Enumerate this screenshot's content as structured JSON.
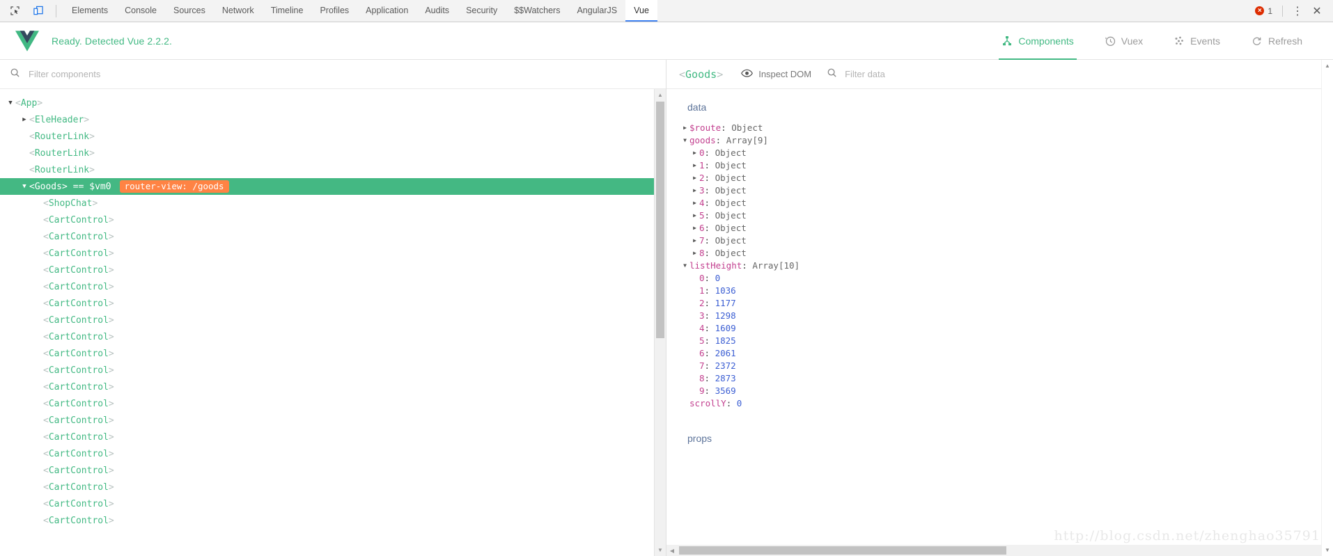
{
  "devtools_toolbar": {
    "icons": [
      {
        "name": "inspect-element-icon",
        "label": "Inspect element"
      },
      {
        "name": "device-toolbar-icon",
        "label": "Toggle device toolbar"
      }
    ],
    "tabs": [
      {
        "label": "Elements",
        "active": false
      },
      {
        "label": "Console",
        "active": false
      },
      {
        "label": "Sources",
        "active": false
      },
      {
        "label": "Network",
        "active": false
      },
      {
        "label": "Timeline",
        "active": false
      },
      {
        "label": "Profiles",
        "active": false
      },
      {
        "label": "Application",
        "active": false
      },
      {
        "label": "Audits",
        "active": false
      },
      {
        "label": "Security",
        "active": false
      },
      {
        "label": "$$Watchers",
        "active": false
      },
      {
        "label": "AngularJS",
        "active": false
      },
      {
        "label": "Vue",
        "active": true
      }
    ],
    "error_count": "1",
    "error_mark": "×",
    "kebab_label": "⋮",
    "close_label": "✕",
    "active_tab_underline_color": "#4285f4",
    "error_color": "#dd2c00"
  },
  "vue_header": {
    "status": "Ready. Detected Vue 2.2.2.",
    "accent_color": "#42b983",
    "nav": [
      {
        "label": "Components",
        "icon": "components-tree-icon",
        "active": true
      },
      {
        "label": "Vuex",
        "icon": "clock-history-icon",
        "active": false
      },
      {
        "label": "Events",
        "icon": "events-dots-icon",
        "active": false
      },
      {
        "label": "Refresh",
        "icon": "refresh-icon",
        "active": false
      }
    ]
  },
  "tree_panel": {
    "filter": {
      "value": "",
      "placeholder": "Filter components",
      "icon": "search-icon"
    },
    "rows": [
      {
        "name": "App",
        "depth": 0,
        "arrow": "down",
        "selected": false
      },
      {
        "name": "EleHeader",
        "depth": 1,
        "arrow": "right",
        "selected": false
      },
      {
        "name": "RouterLink",
        "depth": 1,
        "arrow": "none",
        "selected": false
      },
      {
        "name": "RouterLink",
        "depth": 1,
        "arrow": "none",
        "selected": false
      },
      {
        "name": "RouterLink",
        "depth": 1,
        "arrow": "none",
        "selected": false
      },
      {
        "name": "Goods",
        "depth": 1,
        "arrow": "down",
        "selected": true,
        "vm": "== $vm0",
        "badge": "router-view: /goods"
      },
      {
        "name": "ShopChat",
        "depth": 2,
        "arrow": "none",
        "selected": false
      },
      {
        "name": "CartControl",
        "depth": 2,
        "arrow": "none",
        "selected": false
      },
      {
        "name": "CartControl",
        "depth": 2,
        "arrow": "none",
        "selected": false
      },
      {
        "name": "CartControl",
        "depth": 2,
        "arrow": "none",
        "selected": false
      },
      {
        "name": "CartControl",
        "depth": 2,
        "arrow": "none",
        "selected": false
      },
      {
        "name": "CartControl",
        "depth": 2,
        "arrow": "none",
        "selected": false
      },
      {
        "name": "CartControl",
        "depth": 2,
        "arrow": "none",
        "selected": false
      },
      {
        "name": "CartControl",
        "depth": 2,
        "arrow": "none",
        "selected": false
      },
      {
        "name": "CartControl",
        "depth": 2,
        "arrow": "none",
        "selected": false
      },
      {
        "name": "CartControl",
        "depth": 2,
        "arrow": "none",
        "selected": false
      },
      {
        "name": "CartControl",
        "depth": 2,
        "arrow": "none",
        "selected": false
      },
      {
        "name": "CartControl",
        "depth": 2,
        "arrow": "none",
        "selected": false
      },
      {
        "name": "CartControl",
        "depth": 2,
        "arrow": "none",
        "selected": false
      },
      {
        "name": "CartControl",
        "depth": 2,
        "arrow": "none",
        "selected": false
      },
      {
        "name": "CartControl",
        "depth": 2,
        "arrow": "none",
        "selected": false
      },
      {
        "name": "CartControl",
        "depth": 2,
        "arrow": "none",
        "selected": false
      },
      {
        "name": "CartControl",
        "depth": 2,
        "arrow": "none",
        "selected": false
      },
      {
        "name": "CartControl",
        "depth": 2,
        "arrow": "none",
        "selected": false
      },
      {
        "name": "CartControl",
        "depth": 2,
        "arrow": "none",
        "selected": false
      },
      {
        "name": "CartControl",
        "depth": 2,
        "arrow": "none",
        "selected": false
      }
    ],
    "selected_bg": "#44b883",
    "badge_bg": "#ff8344"
  },
  "inspector": {
    "title_open": "<",
    "title_name": "Goods",
    "title_close": ">",
    "inspect_dom": {
      "label": "Inspect DOM",
      "icon": "eye-icon"
    },
    "filter": {
      "value": "",
      "placeholder": "Filter data",
      "icon": "search-icon"
    },
    "sections": [
      {
        "title": "data"
      },
      {
        "title": "props"
      }
    ],
    "data_rows": [
      {
        "arrow": "right",
        "depth": 0,
        "key": "$route",
        "value": "Object",
        "vtype": "obj"
      },
      {
        "arrow": "down",
        "depth": 0,
        "key": "goods",
        "value": "Array[9]",
        "vtype": "obj"
      },
      {
        "arrow": "right",
        "depth": 1,
        "key": "0",
        "value": "Object",
        "vtype": "obj"
      },
      {
        "arrow": "right",
        "depth": 1,
        "key": "1",
        "value": "Object",
        "vtype": "obj"
      },
      {
        "arrow": "right",
        "depth": 1,
        "key": "2",
        "value": "Object",
        "vtype": "obj"
      },
      {
        "arrow": "right",
        "depth": 1,
        "key": "3",
        "value": "Object",
        "vtype": "obj"
      },
      {
        "arrow": "right",
        "depth": 1,
        "key": "4",
        "value": "Object",
        "vtype": "obj"
      },
      {
        "arrow": "right",
        "depth": 1,
        "key": "5",
        "value": "Object",
        "vtype": "obj"
      },
      {
        "arrow": "right",
        "depth": 1,
        "key": "6",
        "value": "Object",
        "vtype": "obj"
      },
      {
        "arrow": "right",
        "depth": 1,
        "key": "7",
        "value": "Object",
        "vtype": "obj"
      },
      {
        "arrow": "right",
        "depth": 1,
        "key": "8",
        "value": "Object",
        "vtype": "obj"
      },
      {
        "arrow": "down",
        "depth": 0,
        "key": "listHeight",
        "value": "Array[10]",
        "vtype": "obj"
      },
      {
        "arrow": "none",
        "depth": 1,
        "key": "0",
        "value": "0",
        "vtype": "num"
      },
      {
        "arrow": "none",
        "depth": 1,
        "key": "1",
        "value": "1036",
        "vtype": "num"
      },
      {
        "arrow": "none",
        "depth": 1,
        "key": "2",
        "value": "1177",
        "vtype": "num"
      },
      {
        "arrow": "none",
        "depth": 1,
        "key": "3",
        "value": "1298",
        "vtype": "num"
      },
      {
        "arrow": "none",
        "depth": 1,
        "key": "4",
        "value": "1609",
        "vtype": "num"
      },
      {
        "arrow": "none",
        "depth": 1,
        "key": "5",
        "value": "1825",
        "vtype": "num"
      },
      {
        "arrow": "none",
        "depth": 1,
        "key": "6",
        "value": "2061",
        "vtype": "num"
      },
      {
        "arrow": "none",
        "depth": 1,
        "key": "7",
        "value": "2372",
        "vtype": "num"
      },
      {
        "arrow": "none",
        "depth": 1,
        "key": "8",
        "value": "2873",
        "vtype": "num"
      },
      {
        "arrow": "none",
        "depth": 1,
        "key": "9",
        "value": "3569",
        "vtype": "num"
      },
      {
        "arrow": "none",
        "depth": 0,
        "key": "scrollY",
        "value": "0",
        "vtype": "num"
      }
    ]
  },
  "watermark": "http://blog.csdn.net/zhenghao35791"
}
